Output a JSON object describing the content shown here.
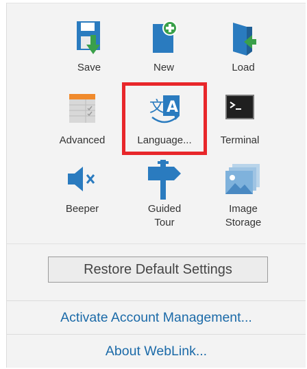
{
  "tiles": [
    {
      "label": "Save",
      "icon": "save-icon"
    },
    {
      "label": "New",
      "icon": "new-file-icon"
    },
    {
      "label": "Load",
      "icon": "load-icon"
    },
    {
      "label": "Advanced",
      "icon": "advanced-table-icon"
    },
    {
      "label": "Language...",
      "icon": "language-icon"
    },
    {
      "label": "Terminal",
      "icon": "terminal-icon"
    },
    {
      "label": "Beeper",
      "icon": "speaker-mute-icon"
    },
    {
      "label_line1": "Guided",
      "label_line2": "Tour",
      "icon": "signpost-icon"
    },
    {
      "label_line1": "Image",
      "label_line2": "Storage",
      "icon": "image-storage-icon"
    }
  ],
  "restore_label": "Restore Default Settings",
  "links": {
    "activate": "Activate Account Management...",
    "about": "About WebLink..."
  },
  "colors": {
    "icon_blue": "#2a7bbf",
    "icon_green": "#3aa04a",
    "highlight_red": "#e8262a",
    "link_blue": "#1b6aa8"
  }
}
